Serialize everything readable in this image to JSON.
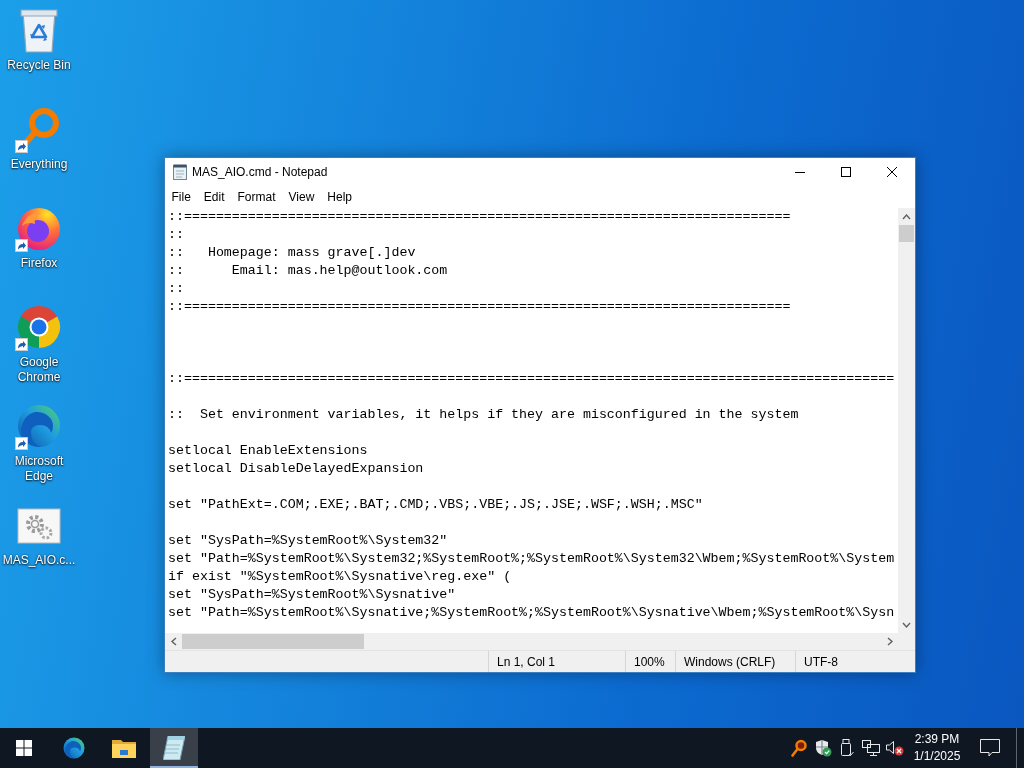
{
  "desktop": {
    "icons": [
      {
        "kind": "recycle-bin",
        "label": "Recycle Bin",
        "shortcut": false
      },
      {
        "kind": "everything",
        "label": "Everything",
        "shortcut": true
      },
      {
        "kind": "firefox",
        "label": "Firefox",
        "shortcut": true
      },
      {
        "kind": "chrome",
        "label": "Google Chrome",
        "shortcut": true
      },
      {
        "kind": "edge",
        "label": "Microsoft Edge",
        "shortcut": true
      },
      {
        "kind": "settings-file",
        "label": "MAS_AIO.c...",
        "shortcut": false
      }
    ]
  },
  "window": {
    "title": "MAS_AIO.cmd - Notepad",
    "menu": [
      "File",
      "Edit",
      "Format",
      "View",
      "Help"
    ],
    "content": "::============================================================================\n::\n::   Homepage: mass grave[.]dev\n::      Email: mas.help@outlook.com\n::\n::============================================================================\n\n\n\n::=========================================================================================\n\n::  Set environment variables, it helps if they are misconfigured in the system\n\nsetlocal EnableExtensions\nsetlocal DisableDelayedExpansion\n\nset \"PathExt=.COM;.EXE;.BAT;.CMD;.VBS;.VBE;.JS;.JSE;.WSF;.WSH;.MSC\"\n\nset \"SysPath=%SystemRoot%\\System32\"\nset \"Path=%SystemRoot%\\System32;%SystemRoot%;%SystemRoot%\\System32\\Wbem;%SystemRoot%\\System\nif exist \"%SystemRoot%\\Sysnative\\reg.exe\" (\nset \"SysPath=%SystemRoot%\\Sysnative\"\nset \"Path=%SystemRoot%\\Sysnative;%SystemRoot%;%SystemRoot%\\Sysnative\\Wbem;%SystemRoot%\\Sysn",
    "status_bar": {
      "position": "Ln 1, Col 1",
      "zoom": "100%",
      "line_endings": "Windows (CRLF)",
      "encoding": "UTF-8"
    }
  },
  "taskbar": {
    "apps": [
      {
        "kind": "edge",
        "selected": false
      },
      {
        "kind": "file-explorer",
        "selected": false
      },
      {
        "kind": "notepad",
        "selected": true
      }
    ],
    "tray": [
      {
        "kind": "everything"
      },
      {
        "kind": "security"
      },
      {
        "kind": "usb"
      },
      {
        "kind": "network"
      },
      {
        "kind": "volume",
        "muted": true
      }
    ],
    "clock": {
      "time": "2:39 PM",
      "date": "1/1/2025"
    }
  }
}
